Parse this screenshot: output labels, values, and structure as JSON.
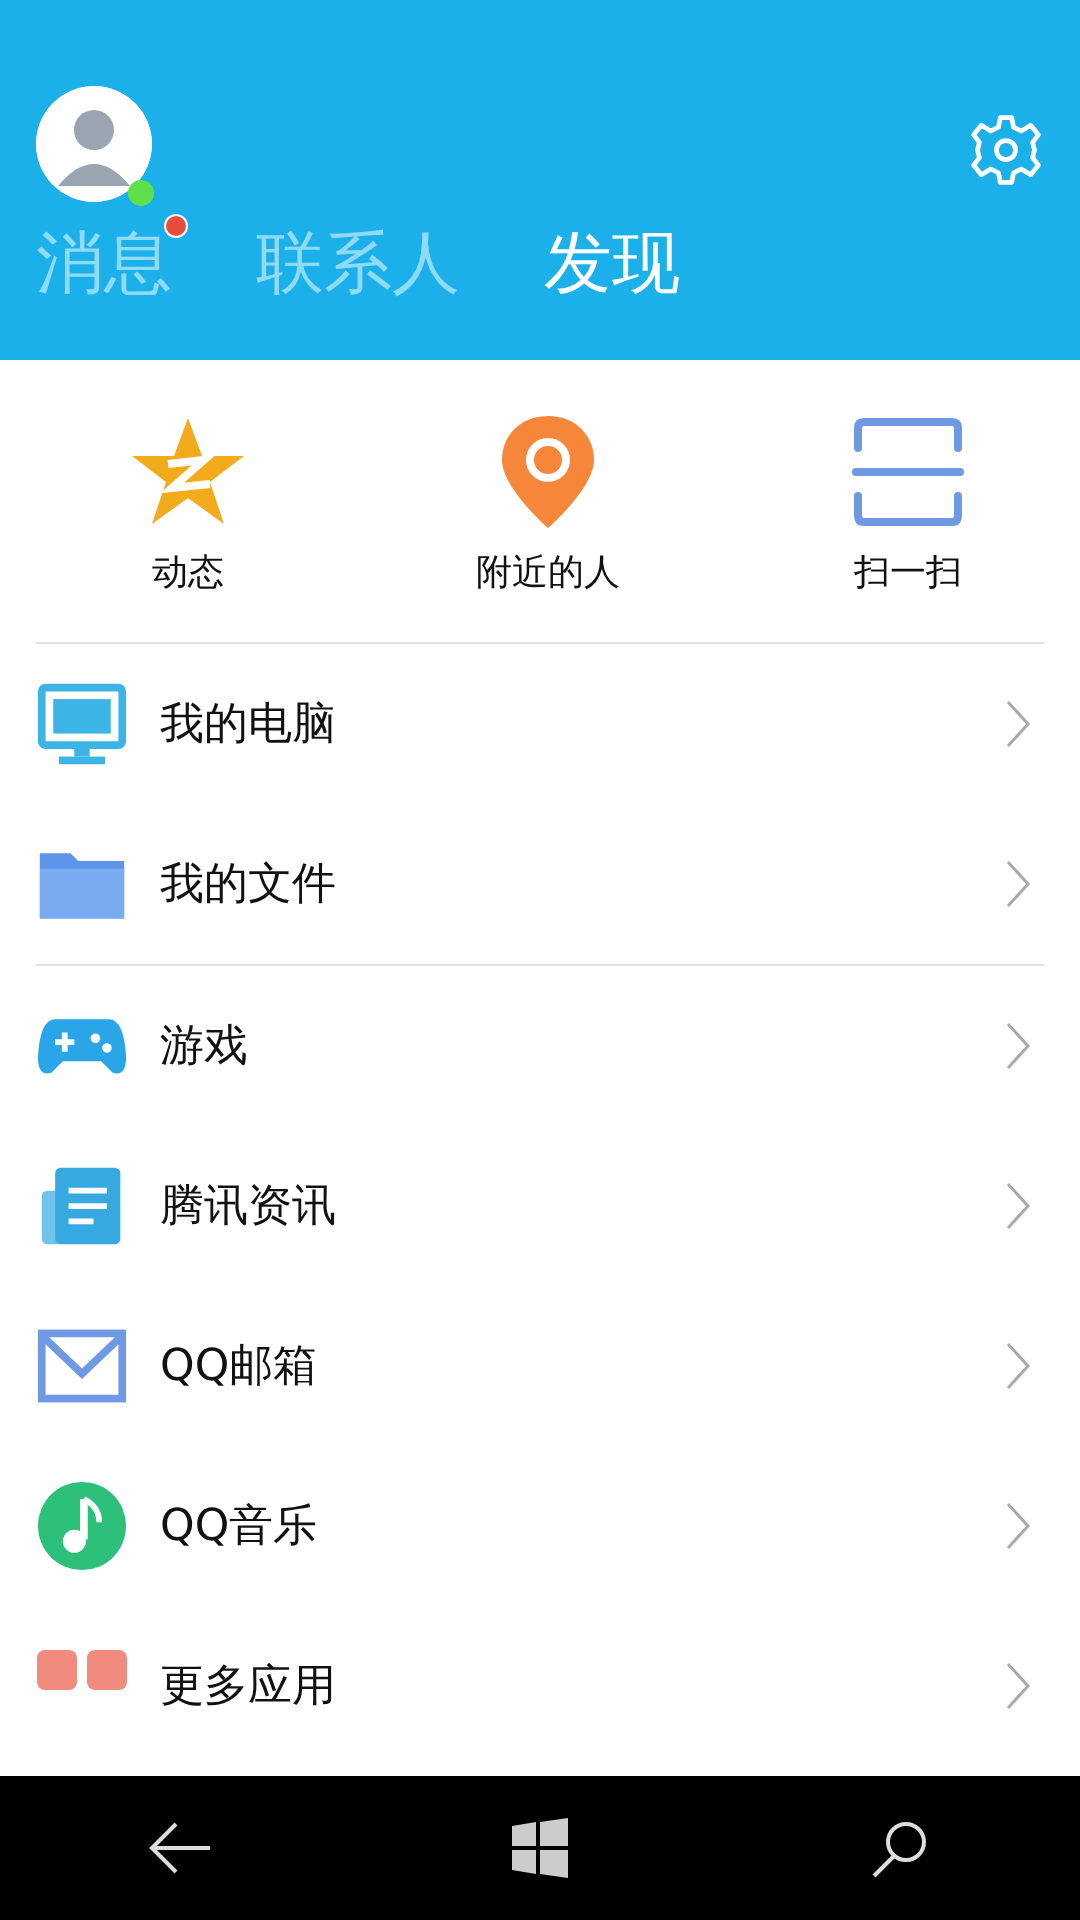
{
  "header": {
    "avatar": {
      "online": true
    },
    "tabs": [
      {
        "label": "消息",
        "selected": false,
        "unread": true
      },
      {
        "label": "联系人",
        "selected": false,
        "unread": false
      },
      {
        "label": "发现",
        "selected": true,
        "unread": false
      }
    ]
  },
  "quick_actions": [
    {
      "kind": "star",
      "label": "动态"
    },
    {
      "kind": "pin",
      "label": "附近的人"
    },
    {
      "kind": "scan",
      "label": "扫一扫"
    }
  ],
  "sections": [
    [
      {
        "kind": "monitor",
        "label": "我的电脑"
      },
      {
        "kind": "folder",
        "label": "我的文件"
      }
    ],
    [
      {
        "kind": "gamepad",
        "label": "游戏"
      },
      {
        "kind": "news",
        "label": "腾讯资讯"
      },
      {
        "kind": "mail",
        "label": "QQ邮箱"
      },
      {
        "kind": "music",
        "label": "QQ音乐"
      },
      {
        "kind": "apps",
        "label": "更多应用"
      }
    ]
  ],
  "nav_bar": [
    {
      "kind": "back"
    },
    {
      "kind": "windows"
    },
    {
      "kind": "search"
    }
  ]
}
